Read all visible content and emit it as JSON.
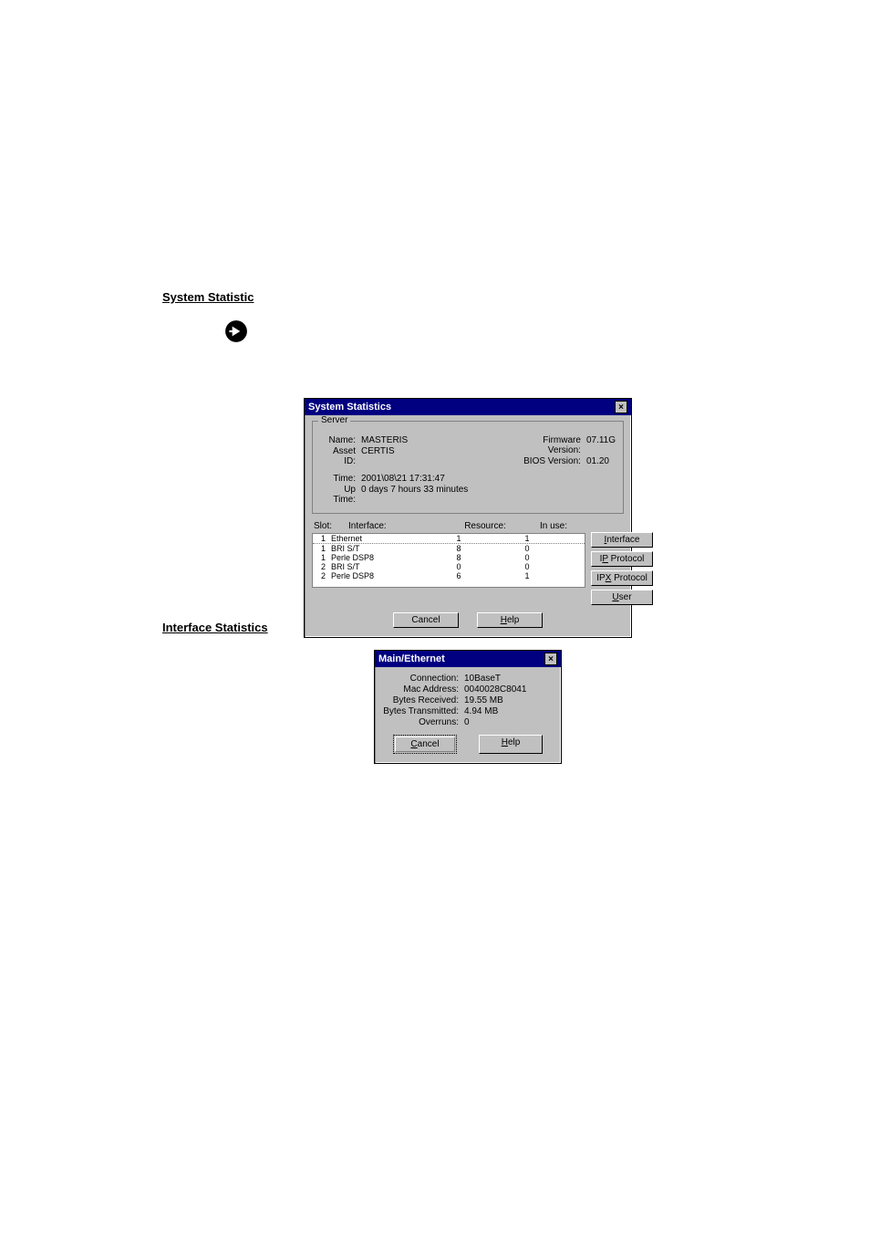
{
  "headings": {
    "system_stats": "System Statistic",
    "interface_stats": "Interface Statistics"
  },
  "dlg_system": {
    "title": "System Statistics",
    "close_x": "×",
    "server_group_label": "Server",
    "name_label": "Name:",
    "name_value": "MASTERIS",
    "assetid_label": "Asset ID:",
    "assetid_value": "CERTIS",
    "time_label": "Time:",
    "time_value": "2001\\08\\21 17:31:47",
    "uptime_label": "Up Time:",
    "uptime_value": "0 days 7 hours 33 minutes",
    "fw_label": "Firmware Version:",
    "fw_value": "07.11G",
    "bios_label": "BIOS Version:",
    "bios_value": "01.20",
    "th_slot": "Slot:",
    "th_intf": "Interface:",
    "th_res": "Resource:",
    "th_use": "In use:",
    "rows": [
      {
        "slot": "1",
        "intf": "Ethernet",
        "res": "1",
        "use": "1"
      },
      {
        "slot": "1",
        "intf": "BRI S/T",
        "res": "8",
        "use": "0"
      },
      {
        "slot": "1",
        "intf": "Perle DSP8",
        "res": "8",
        "use": "0"
      },
      {
        "slot": "2",
        "intf": "BRI S/T",
        "res": "0",
        "use": "0"
      },
      {
        "slot": "2",
        "intf": "Perle DSP8",
        "res": "6",
        "use": "1"
      }
    ],
    "btn_interface_mn": "I",
    "btn_interface_rest": "nterface",
    "btn_ip_pre": "I",
    "btn_ip_mn": "P",
    "btn_ip_rest": " Protocol",
    "btn_ipx_pre": "IP",
    "btn_ipx_mn": "X",
    "btn_ipx_rest": " Protocol",
    "btn_user_mn": "U",
    "btn_user_rest": "ser",
    "btn_cancel": "Cancel",
    "btn_help_mn": "H",
    "btn_help_rest": "elp"
  },
  "dlg_eth": {
    "title": "Main/Ethernet",
    "close_x": "×",
    "conn_label": "Connection:",
    "conn_value": "10BaseT",
    "mac_label": "Mac Address:",
    "mac_value": "0040028C8041",
    "brx_label": "Bytes Received:",
    "brx_value": "19.55 MB",
    "btx_label": "Bytes Transmitted:",
    "btx_value": "4.94 MB",
    "ovr_label": "Overruns:",
    "ovr_value": "0",
    "btn_cancel_mn": "C",
    "btn_cancel_rest": "ancel",
    "btn_help_mn": "H",
    "btn_help_rest": "elp"
  }
}
